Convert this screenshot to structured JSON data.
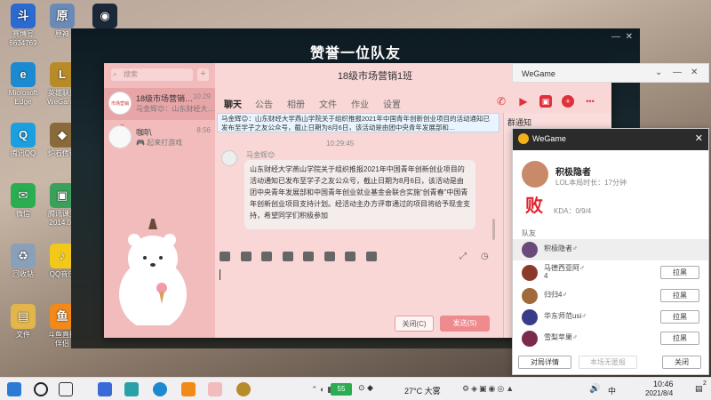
{
  "desktop": {
    "icons": [
      {
        "label": "赛博号\n6634769",
        "color": "#2a6ad1"
      },
      {
        "label": "原神",
        "color": "#6a8ab8"
      },
      {
        "label": "",
        "color": "#1b2838"
      },
      {
        "label": "Microsoft\nEdge",
        "color": "#1b8ad0"
      },
      {
        "label": "英雄联盟\nWeGame",
        "color": "#b78a2a"
      },
      {
        "label": "腾讯QQ",
        "color": "#1aa0e0"
      },
      {
        "label": "炉石传说",
        "color": "#8a6a3a"
      },
      {
        "label": "微信",
        "color": "#2aae51"
      },
      {
        "label": "腾讯课堂\n2014.06",
        "color": "#3aa05a"
      },
      {
        "label": "回收站",
        "color": "#8aa0b8"
      },
      {
        "label": "QQ音乐",
        "color": "#f2c81a"
      },
      {
        "label": "文件",
        "color": "#e2b64a"
      },
      {
        "label": "斗鱼直播\n伴侣",
        "color": "#f28a1a"
      }
    ]
  },
  "game_window": {
    "title": "赞誉一位队友",
    "controls": [
      "—",
      "✕"
    ]
  },
  "qq": {
    "search_placeholder": "搜索",
    "plus": "+",
    "conversations": [
      {
        "name": "18级市场营销…",
        "message": "马金辉😊：山东财经大…",
        "time": "10:29",
        "avatar_text": "市场营销一班"
      },
      {
        "name": "咖叭",
        "message": "🎮 起来打游戏",
        "time": "8:56",
        "avatar_text": ""
      }
    ],
    "title": "18级市场营销1班",
    "window_controls": [
      "✕",
      "—",
      "□",
      "✕"
    ],
    "tabs": [
      "聊天",
      "公告",
      "相册",
      "文件",
      "作业",
      "设置"
    ],
    "notice_bar": "马金辉😊：山东财经大学燕山学院关于组织推报2021年中国青年创新创业项目的活动通知已发布至学子之友公众号，截止日期为8月6日，该活动是由团中央青年发展部和…",
    "chat_time": "10:29:45",
    "sender": "马金辉😊",
    "message": "山东财经大学燕山学院关于组织推报2021年中国青年创新创业项目的活动通知已发布至学子之友公众号，截止日期为8月6日，该活动是由团中央青年发展部和中国青年创业就业基金会联合实施“创青春”中国青年创新创业项目支持计划。经活动主办方评审通过的项目将给予现金支持，希望同学们积极参加",
    "close_label": "关闭(C)",
    "send_label": "发送(S)",
    "right_panel_title": "群通知"
  },
  "wegame_top": {
    "label": "WeGame"
  },
  "wegame": {
    "title": "WeGame",
    "player": "积极隐者",
    "duration": "LOL本局时长：17分钟",
    "result": "败",
    "kda": "KDA：0/9/4",
    "team_label": "队友",
    "members": [
      {
        "name": "积极隐者♂",
        "self": true,
        "button": ""
      },
      {
        "name": "马德西亚阿♂\n4",
        "self": false,
        "button": "拉黑"
      },
      {
        "name": "归归4♂",
        "self": false,
        "button": "拉黑"
      },
      {
        "name": "华东师范usi♂",
        "self": false,
        "button": "拉黑"
      },
      {
        "name": "雪梨苹果♂",
        "self": false,
        "button": "拉黑"
      }
    ],
    "btn_detail": "对局详情",
    "btn_noreport": "本场无匿报",
    "btn_close": "关闭"
  },
  "taskbar": {
    "weather": "27°C 大雾",
    "time": "10:46",
    "date": "2021/8/4",
    "lang": "中",
    "notif_count": "2",
    "game_pill": "5​5"
  }
}
